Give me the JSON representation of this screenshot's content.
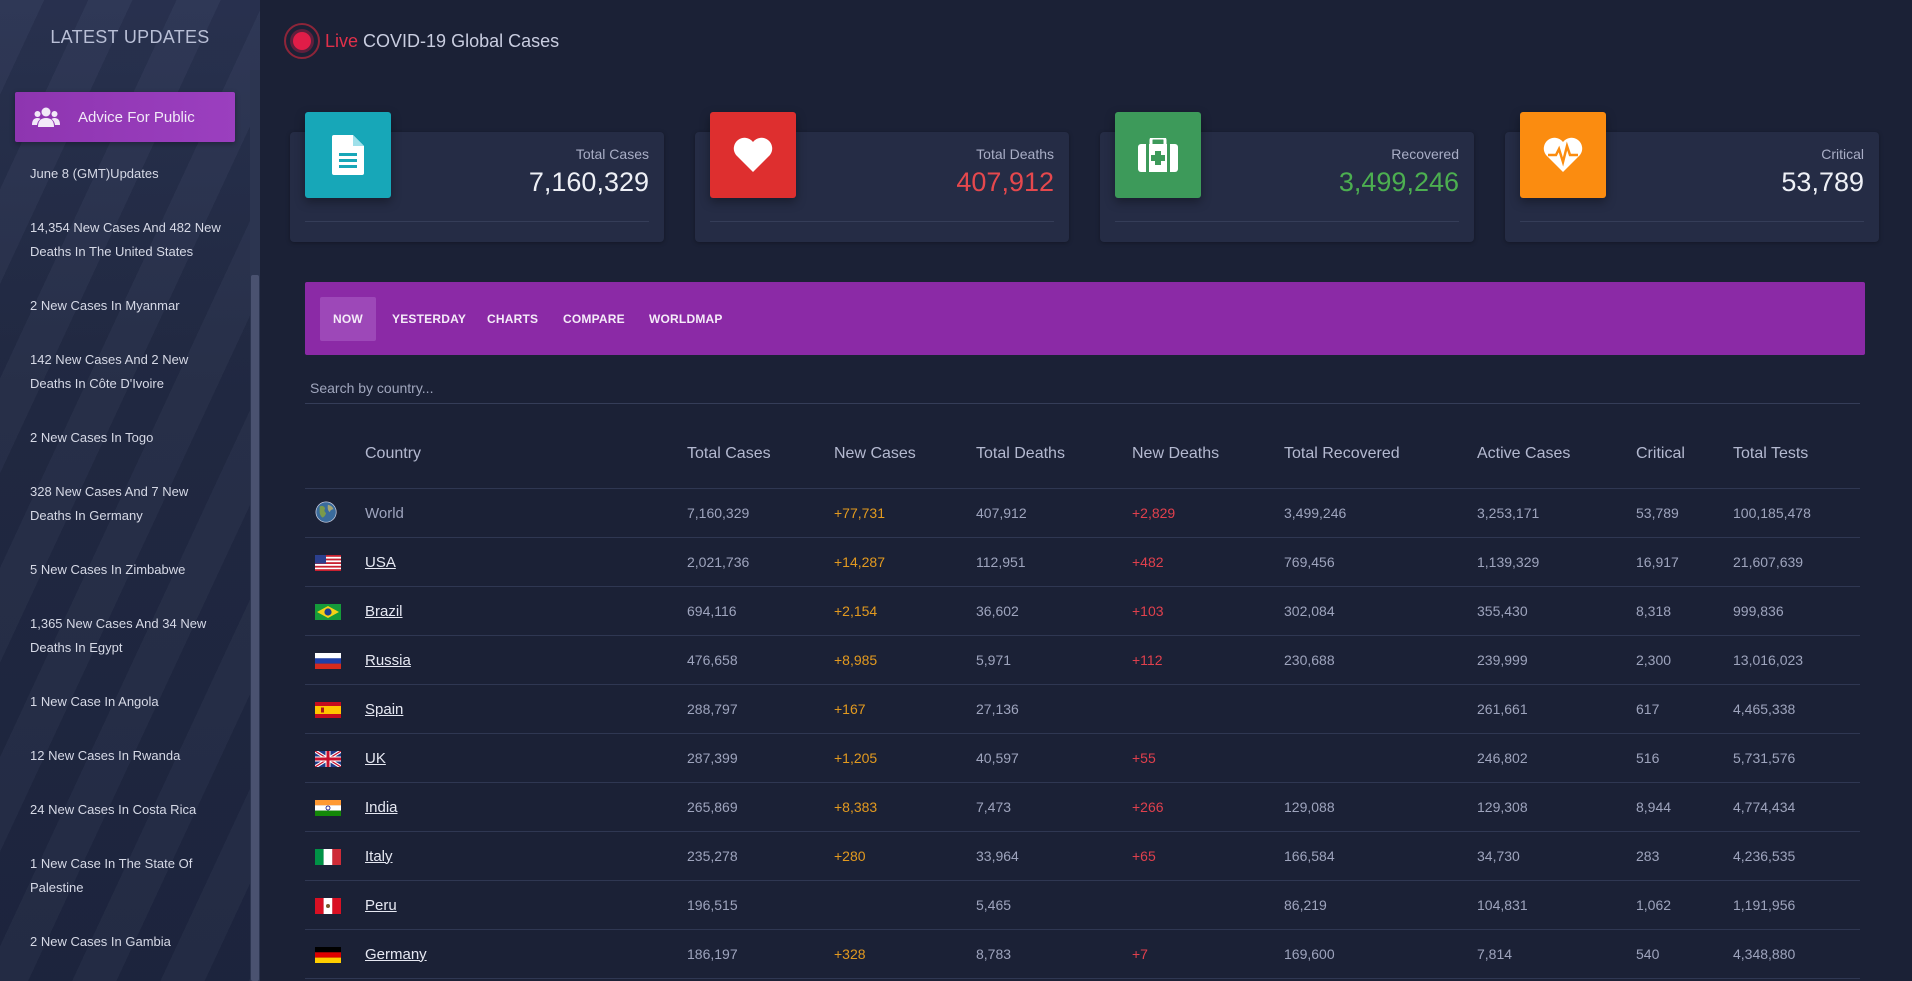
{
  "sidebar": {
    "title": "LATEST UPDATES",
    "advice_label": "Advice For Public",
    "updates": [
      "June 8 (GMT)Updates",
      "14,354 New Cases And 482 New Deaths In The United States",
      "2 New Cases In Myanmar",
      "142 New Cases And 2 New Deaths In Côte D'Ivoire",
      "2 New Cases In Togo",
      "328 New Cases And 7 New Deaths In Germany",
      "5 New Cases In Zimbabwe",
      "1,365 New Cases And 34 New Deaths In Egypt",
      "1 New Case In Angola",
      "12 New Cases In Rwanda",
      "24 New Cases In Costa Rica",
      "1 New Case In The State Of Palestine",
      "2 New Cases In Gambia"
    ]
  },
  "header": {
    "live": "Live",
    "title": "COVID-19 Global Cases"
  },
  "cards": [
    {
      "label": "Total Cases",
      "value": "7,160,329",
      "icon": "document-icon",
      "color": "#17a2b8"
    },
    {
      "label": "Total Deaths",
      "value": "407,912",
      "icon": "heart-icon",
      "color": "#e53935"
    },
    {
      "label": "Recovered",
      "value": "3,499,246",
      "icon": "medkit-icon",
      "color": "#43a047"
    },
    {
      "label": "Critical",
      "value": "53,789",
      "icon": "heartbeat-icon",
      "color": "#fb8c00"
    }
  ],
  "tabs": [
    "NOW",
    "YESTERDAY",
    "CHARTS",
    "COMPARE",
    "WORLDMAP"
  ],
  "search": {
    "placeholder": "Search by country..."
  },
  "table": {
    "headers": [
      "Country",
      "Total Cases",
      "New Cases",
      "Total Deaths",
      "New Deaths",
      "Total Recovered",
      "Active Cases",
      "Critical",
      "Total Tests"
    ],
    "rows": [
      [
        "World",
        "7,160,329",
        "+77,731",
        "407,912",
        "+2,829",
        "3,499,246",
        "3,253,171",
        "53,789",
        "100,185,478"
      ],
      [
        "USA",
        "2,021,736",
        "+14,287",
        "112,951",
        "+482",
        "769,456",
        "1,139,329",
        "16,917",
        "21,607,639"
      ],
      [
        "Brazil",
        "694,116",
        "+2,154",
        "36,602",
        "+103",
        "302,084",
        "355,430",
        "8,318",
        "999,836"
      ],
      [
        "Russia",
        "476,658",
        "+8,985",
        "5,971",
        "+112",
        "230,688",
        "239,999",
        "2,300",
        "13,016,023"
      ],
      [
        "Spain",
        "288,797",
        "+167",
        "27,136",
        "",
        "",
        "261,661",
        "617",
        "4,465,338"
      ],
      [
        "UK",
        "287,399",
        "+1,205",
        "40,597",
        "+55",
        "",
        "246,802",
        "516",
        "5,731,576"
      ],
      [
        "India",
        "265,869",
        "+8,383",
        "7,473",
        "+266",
        "129,088",
        "129,308",
        "8,944",
        "4,774,434"
      ],
      [
        "Italy",
        "235,278",
        "+280",
        "33,964",
        "+65",
        "166,584",
        "34,730",
        "283",
        "4,236,535"
      ],
      [
        "Peru",
        "196,515",
        "",
        "5,465",
        "",
        "86,219",
        "104,831",
        "1,062",
        "1,191,956"
      ],
      [
        "Germany",
        "186,197",
        "+328",
        "8,783",
        "+7",
        "169,600",
        "7,814",
        "540",
        "4,348,880"
      ]
    ]
  }
}
